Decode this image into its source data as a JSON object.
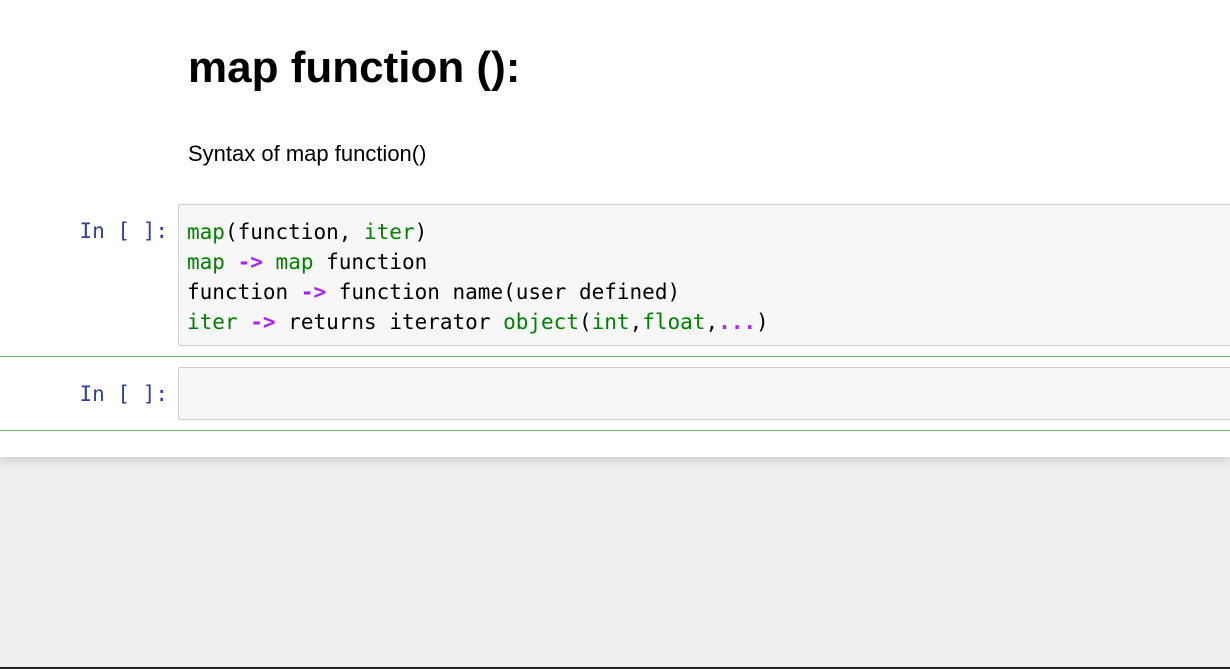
{
  "markdown": {
    "title": "map function ():",
    "text": "Syntax of map function()"
  },
  "cells": [
    {
      "prompt": "In [ ]:",
      "lines": [
        [
          {
            "t": "map",
            "k": "builtin"
          },
          {
            "t": "(function, ",
            "k": "plain"
          },
          {
            "t": "iter",
            "k": "builtin"
          },
          {
            "t": ")",
            "k": "plain"
          }
        ],
        [
          {
            "t": "map",
            "k": "builtin"
          },
          {
            "t": " ",
            "k": "plain"
          },
          {
            "t": "->",
            "k": "op"
          },
          {
            "t": " ",
            "k": "plain"
          },
          {
            "t": "map",
            "k": "builtin"
          },
          {
            "t": " function",
            "k": "plain"
          }
        ],
        [
          {
            "t": "function ",
            "k": "plain"
          },
          {
            "t": "->",
            "k": "op"
          },
          {
            "t": " function name(user defined)",
            "k": "plain"
          }
        ],
        [
          {
            "t": "iter",
            "k": "builtin"
          },
          {
            "t": " ",
            "k": "plain"
          },
          {
            "t": "->",
            "k": "op"
          },
          {
            "t": " returns iterator ",
            "k": "plain"
          },
          {
            "t": "object",
            "k": "builtin"
          },
          {
            "t": "(",
            "k": "plain"
          },
          {
            "t": "int",
            "k": "builtin"
          },
          {
            "t": ",",
            "k": "plain"
          },
          {
            "t": "float",
            "k": "builtin"
          },
          {
            "t": ",",
            "k": "plain"
          },
          {
            "t": "...",
            "k": "op"
          },
          {
            "t": ")",
            "k": "plain"
          }
        ]
      ]
    },
    {
      "prompt": "In [ ]:",
      "lines": []
    }
  ],
  "colors": {
    "prompt": "#303f9f",
    "builtin": "#008000",
    "operator": "#aa22ff",
    "selected_cell_border": "#66bb6a",
    "input_background": "#f7f7f7",
    "page_background": "#eeeeee"
  }
}
